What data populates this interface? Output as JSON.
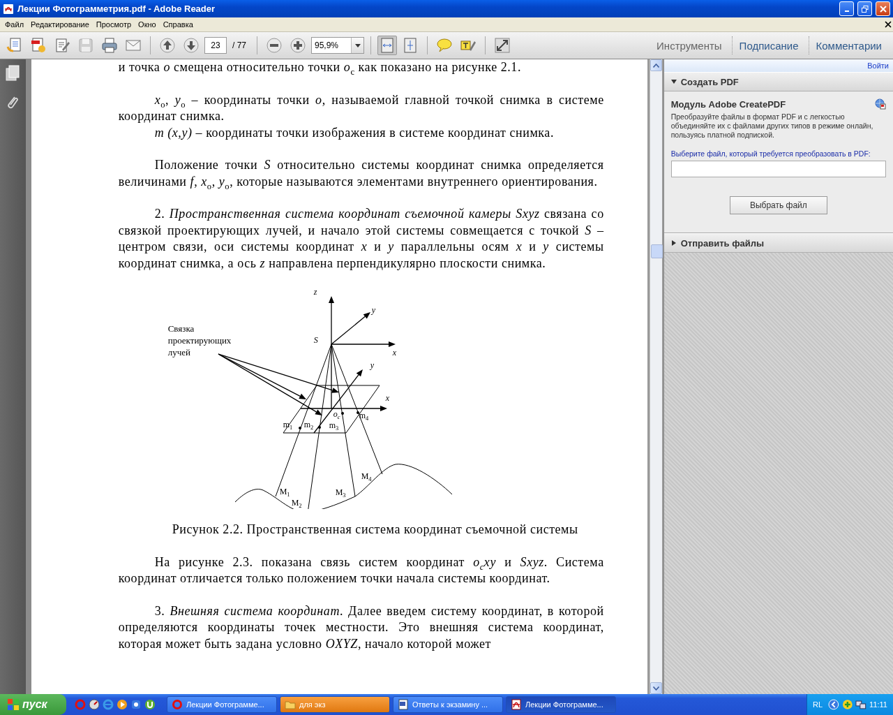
{
  "window": {
    "title": "Лекции Фотограмметрия.pdf - Adobe Reader"
  },
  "menu": [
    "Файл",
    "Редактирование",
    "Просмотр",
    "Окно",
    "Справка"
  ],
  "toolbar": {
    "page": "23",
    "page_count": "/ 77",
    "zoom": "95,9%",
    "save_disabled": true,
    "tabs": [
      {
        "label": "Инструменты",
        "dimmed": true
      },
      {
        "label": "Подписание",
        "dimmed": false
      },
      {
        "label": "Комментарии",
        "dimmed": false
      }
    ]
  },
  "document": {
    "before": [
      {
        "paragraphs": [
          {
            "text": "и точка *o* смещена относительно точки *o*$_{c}$ как показано на рисунке 2.1.",
            "indent": false
          }
        ]
      },
      {
        "paragraphs": [
          {
            "text": "*x*$_{o}$, *y*$_{o}$ – координаты точки *o*, называемой главной точкой снимка в системе координат снимка.",
            "indent": true
          },
          {
            "text": "*m (x,y)* – координаты точки изображения в системе координат снимка.",
            "indent": true
          }
        ]
      },
      {
        "paragraphs": [
          {
            "text": "Положение точки *S* относительно системы координат снимка определяется величинами *f*, *x*$_{o}$, *y*$_{o}$, которые называются элементами внутреннего ориентирования.",
            "indent": true
          }
        ]
      },
      {
        "paragraphs": [
          {
            "text": "2. *Пространственная система координат съемочной камеры Sxyz* связана со связкой проектирующих лучей, и начало этой системы совмещается с точкой *S* – центром связи, оси системы координат *x* и *y* параллельны осям *x* и *y* системы координат снимка, а ось *z* направлена перпендикулярно плоскости снимка.",
            "indent": true
          }
        ]
      }
    ],
    "figure": {
      "labels": [
        {
          "text": "z",
          "kind": "axis"
        },
        {
          "text": "S",
          "kind": "axis"
        },
        {
          "text": "y",
          "kind": "axis"
        },
        {
          "text": "x",
          "kind": "axis"
        },
        {
          "text": "y",
          "kind": "axis"
        },
        {
          "text": "x",
          "kind": "axis"
        },
        {
          "text": "o$_{c}$",
          "kind": "axis"
        },
        {
          "text": "m$_{1}$",
          "kind": "point"
        },
        {
          "text": "m$_{2}$",
          "kind": "point"
        },
        {
          "text": "m$_{3}$",
          "kind": "point"
        },
        {
          "text": "m$_{4}$",
          "kind": "point"
        },
        {
          "text": "M$_{1}$",
          "kind": "point"
        },
        {
          "text": "M$_{2}$",
          "kind": "point"
        },
        {
          "text": "M$_{3}$",
          "kind": "point"
        },
        {
          "text": "M$_{4}$",
          "kind": "point"
        },
        {
          "text": "Связка проектирующих лучей",
          "kind": "callout"
        }
      ]
    },
    "caption": "Рисунок 2.2. Пространственная система координат съемочной системы",
    "after": [
      {
        "paragraphs": [
          {
            "text": "На рисунке 2.3. показана связь систем координат *o$_{c}$xy* и *Sxyz*. Система координат отличается только положением точки начала системы координат.",
            "indent": true
          }
        ]
      },
      {
        "paragraphs": [
          {
            "text": "3. *Внешняя система координат*. Далее введем систему координат, в которой определяются координаты точек местности. Это внешняя система координат, которая может быть задана условно *OXYZ*, начало которой может",
            "indent": true
          }
        ]
      }
    ]
  },
  "panel": {
    "login": "Войти",
    "sections": [
      {
        "title": "Создать PDF",
        "expanded": true,
        "module_title": "Модуль Adobe CreatePDF",
        "description": "Преобразуйте файлы в формат PDF и с легкостью объединяйте их с файлами других типов в режиме онлайн, пользуясь платной подпиской.",
        "prompt": "Выберите файл, который требуется преобразовать в PDF:",
        "button": "Выбрать файл"
      },
      {
        "title": "Отправить файлы",
        "expanded": false
      }
    ]
  },
  "taskbar": {
    "start": "пуск",
    "tasks": [
      {
        "label": "Лекции Фотограмме...",
        "kind": "browser",
        "selected": false,
        "flashing": false
      },
      {
        "label": "для экз",
        "kind": "folder",
        "selected": false,
        "flashing": true
      },
      {
        "label": "Ответы к экзамину ...",
        "kind": "document",
        "selected": false,
        "flashing": false
      },
      {
        "label": "Лекции Фотограмме...",
        "kind": "pdf",
        "selected": true,
        "flashing": false
      }
    ],
    "lang": "RL",
    "clock": "11:11"
  }
}
